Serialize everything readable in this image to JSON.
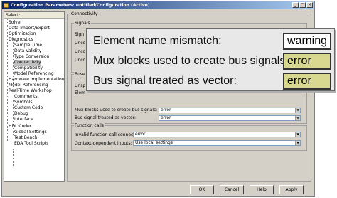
{
  "window": {
    "title": "Configuration Parameters: untitled/Configuration (Active)",
    "buttons": {
      "minimize": "_",
      "maximize": "□",
      "close": "×"
    }
  },
  "select_panel": {
    "header": "Select:",
    "items": [
      "Solver",
      "Data Import/Export",
      "Optimization",
      "Diagnostics",
      "Sample Time",
      "Data Validity",
      "Type Conversion",
      "Connectivity",
      "Compatibility",
      "Model Referencing",
      "Hardware Implementation",
      "Model Referencing",
      "Real-Time Workshop",
      "Comments",
      "Symbols",
      "Custom Code",
      "Debug",
      "Interface",
      "HDL Coder",
      "Global Settings",
      "Test Bench",
      "EDA Tool Scripts"
    ],
    "selected": "Connectivity"
  },
  "connectivity": {
    "title": "Connectivity",
    "signals": {
      "title": "Signals",
      "labels": [
        "Sign",
        "Unco",
        "Unco",
        "Unco"
      ]
    },
    "buses": {
      "title": "Buse",
      "labels": [
        "Unsp",
        "Elem"
      ],
      "mux_label": "Mux blocks used to create bus signals:",
      "mux_value": "error",
      "bus_vector_label": "Bus signal treated as vector:",
      "bus_vector_value": "error"
    },
    "function_calls": {
      "title": "Function calls",
      "invalid_label": "Invalid function-call connection:",
      "invalid_value": "error",
      "context_label": "Context-dependent inputs:",
      "context_value": "Use local settings"
    }
  },
  "buttons": {
    "ok": "OK",
    "cancel": "Cancel",
    "help": "Help",
    "apply": "Apply"
  },
  "callout": {
    "rows": [
      {
        "label": "Element name mismatch:",
        "value": "warning"
      },
      {
        "label": "Mux blocks used to create bus signals:",
        "value": "error"
      },
      {
        "label": "Bus signal treated as vector:",
        "value": "error"
      }
    ]
  },
  "colors": {
    "highlight_field": "#d8d890",
    "plain_field": "#ffffff",
    "titlebar": "#0a246a"
  }
}
